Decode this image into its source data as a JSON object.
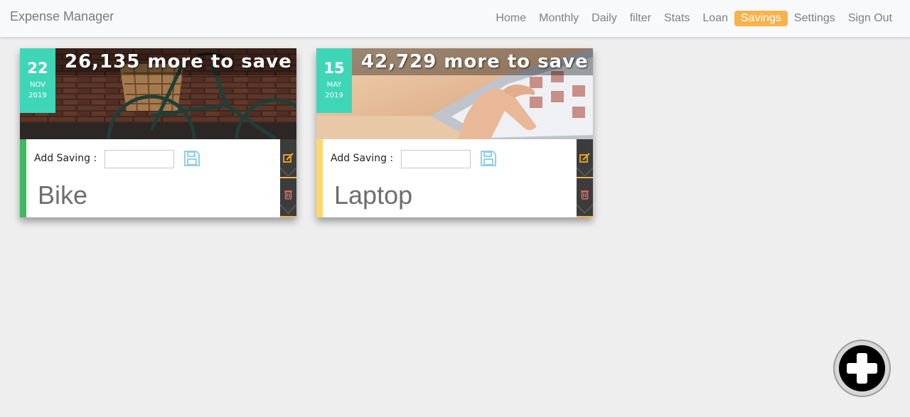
{
  "app": {
    "title": "Expense Manager"
  },
  "nav": {
    "items": [
      {
        "label": "Home",
        "active": false
      },
      {
        "label": "Monthly",
        "active": false
      },
      {
        "label": "Daily",
        "active": false
      },
      {
        "label": "filter",
        "active": false
      },
      {
        "label": "Stats",
        "active": false
      },
      {
        "label": "Loan",
        "active": false
      },
      {
        "label": "Savings",
        "active": true
      },
      {
        "label": "Settings",
        "active": false
      },
      {
        "label": "Sign Out",
        "active": false
      }
    ]
  },
  "savings": [
    {
      "day": "22",
      "month": "NOV",
      "year": "2019",
      "banner": "26,135 more to save",
      "add_label": "Add Saving :",
      "input_value": "",
      "name": "Bike",
      "accent_color": "#3cb95c",
      "image": "bicycle-photo"
    },
    {
      "day": "15",
      "month": "MAY",
      "year": "2019",
      "banner": "42,729 more to save",
      "add_label": "Add Saving :",
      "input_value": "",
      "name": "Laptop",
      "accent_color": "#ffd76b",
      "image": "laptop-photo"
    }
  ],
  "colors": {
    "date_box": "#3fd6b8",
    "nav_active": "#f7b24b",
    "save_icon": "#8fd0e6",
    "edit_icon": "#f5a623",
    "delete_icon": "#e06666",
    "side_panel": "#3c3c3c"
  },
  "icons": {
    "save": "floppy-disk-icon",
    "edit": "edit-icon",
    "delete": "trash-icon",
    "add": "plus-circle-icon"
  }
}
